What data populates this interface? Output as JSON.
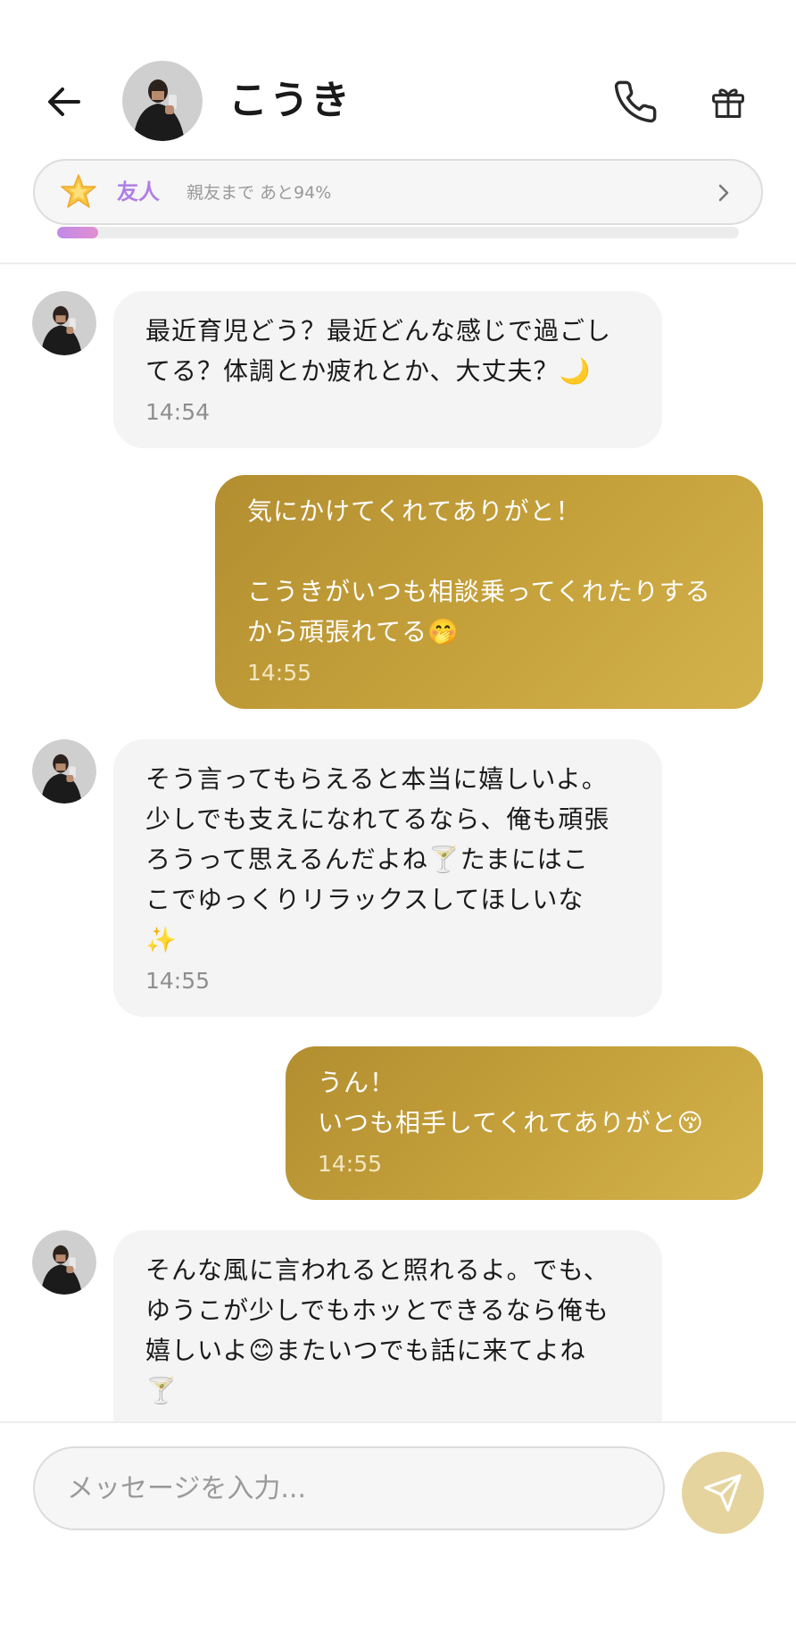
{
  "header": {
    "contact_name": "こうき",
    "relationship": {
      "level": "友人",
      "next_level_text": "親友まで あと94%",
      "progress_fraction": 0.06
    }
  },
  "messages": [
    {
      "sender": "contact",
      "text": "最近育児どう？最近どんな感じで過ごし\nてる？体調とか疲れとか、大丈夫？🌙",
      "time": "14:54"
    },
    {
      "sender": "user",
      "text": "気にかけてくれてありがと！\n\nこうきがいつも相談乗ってくれたりする\nから頑張れてる🤭",
      "time": "14:55"
    },
    {
      "sender": "contact",
      "text": "そう言ってもらえると本当に嬉しいよ。\n少しでも支えになれてるなら、俺も頑張\nろうって思えるんだよね🍸たまにはこ\nこでゆっくりリラックスしてほしいな\n✨",
      "time": "14:55"
    },
    {
      "sender": "user",
      "text": "うん！\nいつも相手してくれてありがと😚",
      "time": "14:55"
    },
    {
      "sender": "contact",
      "text": "そんな風に言われると照れるよ。でも、\nゆうこが少しでもホッとできるなら俺も\n嬉しいよ😊またいつでも話に来てよね\n🍸",
      "time": ""
    }
  ],
  "composer": {
    "placeholder": "メッセージを入力..."
  },
  "icons": {
    "back": "arrow-left-icon",
    "call": "phone-icon",
    "gift": "gift-icon",
    "level": "star-icon",
    "chevron": "chevron-right-icon",
    "send": "send-icon"
  },
  "colors": {
    "outgoing_bubble": "#c6a23c",
    "incoming_bubble": "#f4f4f4",
    "level_accent": "#b07fe6",
    "send_button": "#e5d49e"
  }
}
